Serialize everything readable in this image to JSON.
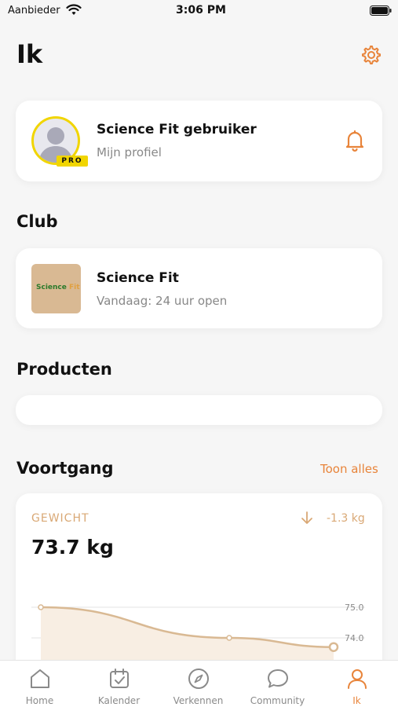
{
  "status_bar": {
    "carrier": "Aanbieder",
    "time": "3:06 PM"
  },
  "page": {
    "title": "Ik"
  },
  "profile": {
    "name": "Science Fit gebruiker",
    "subtitle": "Mijn profiel",
    "badge": "PRO"
  },
  "club_section": {
    "title": "Club"
  },
  "club": {
    "logo_text_a": "Science",
    "logo_text_b": "Fit",
    "name": "Science Fit",
    "hours": "Vandaag: 24 uur open"
  },
  "products_section": {
    "title": "Producten"
  },
  "progress_section": {
    "title": "Voortgang",
    "link": "Toon alles"
  },
  "metric": {
    "label": "GEWICHT",
    "value": "73.7 kg",
    "delta": "-1.3 kg"
  },
  "chart_data": {
    "type": "area",
    "y_ticks": [
      "75.0",
      "74.0"
    ],
    "series": [
      {
        "values": [
          75.0,
          74.0,
          73.7
        ]
      }
    ]
  },
  "tabs": [
    {
      "label": "Home",
      "icon": "home-icon",
      "active": false
    },
    {
      "label": "Kalender",
      "icon": "calendar-icon",
      "active": false
    },
    {
      "label": "Verkennen",
      "icon": "compass-icon",
      "active": false
    },
    {
      "label": "Community",
      "icon": "chat-icon",
      "active": false
    },
    {
      "label": "Ik",
      "icon": "person-icon",
      "active": true
    }
  ],
  "colors": {
    "accent": "#e8843a",
    "pro_badge": "#f1d500",
    "chart_line": "#d9b993"
  }
}
